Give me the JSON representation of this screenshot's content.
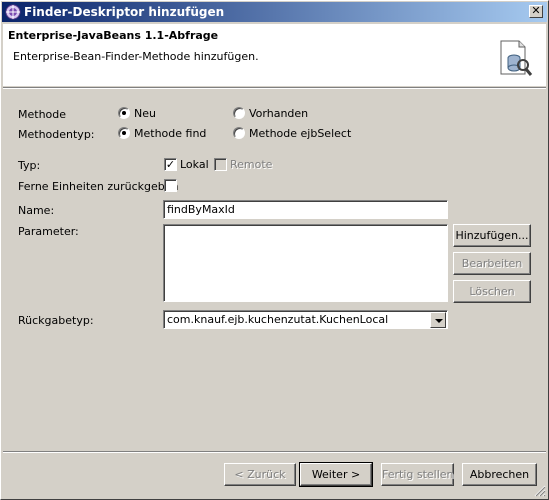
{
  "window": {
    "title": "Finder-Deskriptor hinzufügen"
  },
  "header": {
    "title": "Enterprise-JavaBeans 1.1-Abfrage",
    "subtitle": "Enterprise-Bean-Finder-Methode hinzufügen."
  },
  "form": {
    "methode": {
      "label": "Methode",
      "options": [
        {
          "label": "Neu",
          "checked": true
        },
        {
          "label": "Vorhanden",
          "checked": false
        }
      ]
    },
    "methodentyp": {
      "label": "Methodentyp:",
      "options": [
        {
          "label": "Methode find",
          "checked": true
        },
        {
          "label": "Methode ejbSelect",
          "checked": false
        }
      ]
    },
    "typ": {
      "label": "Typ:",
      "lokal": {
        "label": "Lokal",
        "checked": true
      },
      "remote": {
        "label": "Remote",
        "checked": false,
        "disabled": true
      }
    },
    "ferne": {
      "label": "Ferne Einheiten zurückgeben",
      "checked": false
    },
    "name": {
      "label": "Name:",
      "value": "findByMaxId"
    },
    "parameter": {
      "label": "Parameter:",
      "add_button": "Hinzufügen...",
      "edit_button": "Bearbeiten",
      "delete_button": "Löschen"
    },
    "rueckgabetyp": {
      "label": "Rückgabetyp:",
      "value": "com.knauf.ejb.kuchenzutat.KuchenLocal"
    }
  },
  "footer": {
    "back_button": "< Zurück",
    "next_button": "Weiter >",
    "finish_button": "Fertig stellen",
    "cancel_button": "Abbrechen"
  },
  "colors": {
    "titlebar_start": "#0a246a",
    "titlebar_end": "#a6caf0",
    "dialog_bg": "#d4d0c8"
  }
}
